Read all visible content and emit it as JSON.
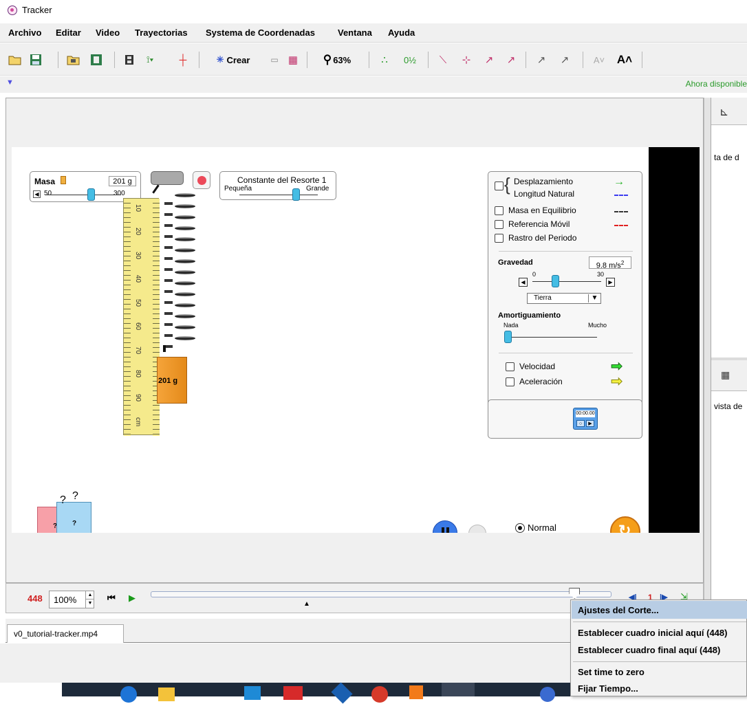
{
  "window": {
    "title": "Tracker"
  },
  "menubar": [
    "Archivo",
    "Editar",
    "Video",
    "Trayectorias",
    "Systema de Coordenadas",
    "Ventana",
    "Ayuda"
  ],
  "toolbar": {
    "create_label": "Crear",
    "zoom_label": "63%"
  },
  "notice": "Ahora disponible",
  "sim": {
    "mass_panel": {
      "title": "Masa",
      "value": "201 g",
      "min": "50",
      "max": "300",
      "slider_fraction": 0.6
    },
    "spring_panel": {
      "title": "Constante del Resorte 1",
      "small": "Pequeña",
      "large": "Grande",
      "slider_fraction": 0.72
    },
    "ruler": {
      "ticks": [
        "10",
        "20",
        "30",
        "40",
        "50",
        "60",
        "70",
        "80",
        "90",
        "cm"
      ]
    },
    "hanging_mass": "201 g",
    "unknown_mark": "?",
    "options": {
      "items": [
        "Desplazamiento",
        "Longitud Natural",
        "Masa en Equilibrio",
        "Referencia Móvil",
        "Rastro del Periodo"
      ],
      "gravity_label": "Gravedad",
      "gravity_value": "9.8 m/s",
      "gravity_unit_sup": "2",
      "gravity_min": "0",
      "gravity_max": "30",
      "gravity_fraction": 0.33,
      "planet": "Tierra",
      "damping_label": "Amortiguamiento",
      "damping_min": "Nada",
      "damping_max": "Mucho",
      "damping_fraction": 0.0,
      "velocity": "Velocidad",
      "acceleration": "Aceleración",
      "colors": {
        "displacement": "#22b022",
        "natural": "#3a3af0",
        "equilibrium": "#333333",
        "reference": "#e02020",
        "velocity": "#33dd33",
        "acceleration": "#f4f040"
      }
    },
    "timer": "00:00.00",
    "speed_option": "Normal"
  },
  "playbar": {
    "frame": "448",
    "zoom": "100%",
    "slider_fraction": 0.92,
    "right_number": "1"
  },
  "right_panel": {
    "top_text": "ta de d",
    "bottom_text": "vista de"
  },
  "tab": {
    "label": "v0_tutorial-tracker.mp4"
  },
  "context_menu": {
    "items": [
      "Ajustes del Corte...",
      "Establecer cuadro inicial aquí (448)",
      "Establecer cuadro final aquí (448)",
      "Set time to zero",
      "Fijar Tiempo..."
    ]
  }
}
